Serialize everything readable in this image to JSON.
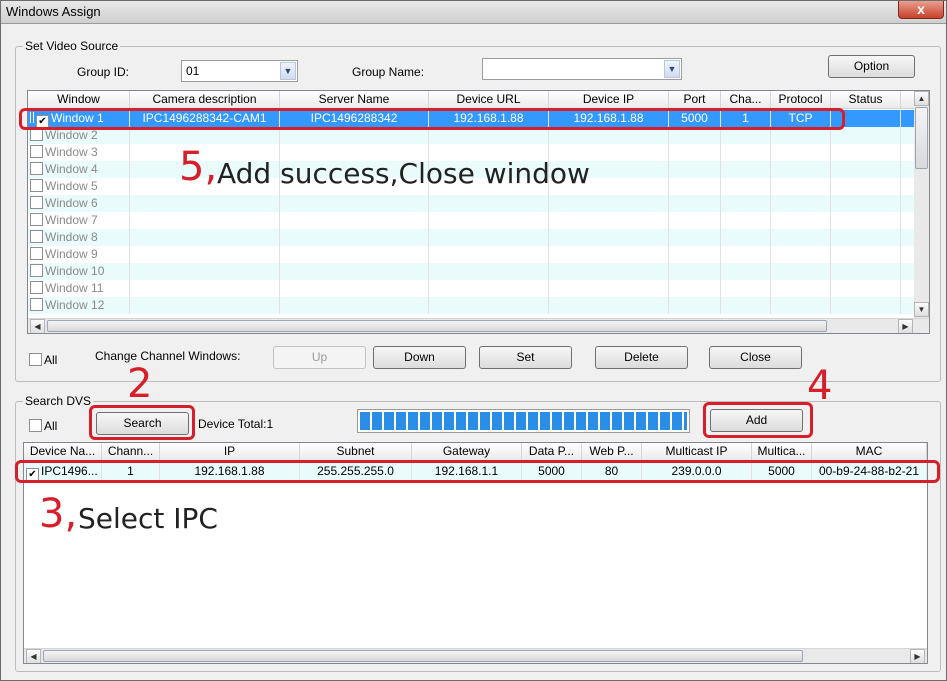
{
  "window": {
    "title": "Windows Assign",
    "close_glyph": "x"
  },
  "video_source": {
    "legend": "Set Video Source",
    "group_id_label": "Group ID:",
    "group_id_value": "01",
    "group_name_label": "Group Name:",
    "group_name_value": "",
    "option_button": "Option",
    "columns": [
      "Window",
      "Camera description",
      "Server Name",
      "Device URL",
      "Device IP",
      "Port",
      "Cha...",
      "Protocol",
      "Status"
    ],
    "rows": [
      {
        "window": "Window 1",
        "checked": true,
        "camera": "IPC1496288342-CAM1",
        "server": "IPC1496288342",
        "url": "192.168.1.88",
        "ip": "192.168.1.88",
        "port": "5000",
        "channel": "1",
        "protocol": "TCP",
        "status": ""
      },
      {
        "window": "Window 2"
      },
      {
        "window": "Window 3"
      },
      {
        "window": "Window 4"
      },
      {
        "window": "Window 5"
      },
      {
        "window": "Window 6"
      },
      {
        "window": "Window 7"
      },
      {
        "window": "Window 8"
      },
      {
        "window": "Window 9"
      },
      {
        "window": "Window 10"
      },
      {
        "window": "Window 11"
      },
      {
        "window": "Window 12"
      }
    ],
    "all_label": "All",
    "change_label": "Change Channel Windows:",
    "buttons": {
      "up": "Up",
      "down": "Down",
      "set": "Set",
      "delete": "Delete",
      "close": "Close"
    }
  },
  "search_dvs": {
    "legend": "Search DVS",
    "all_label": "All",
    "search_button": "Search",
    "device_total": "Device Total:1",
    "progress_percent": 100,
    "add_button": "Add",
    "columns": [
      "Device Na...",
      "Chann...",
      "IP",
      "Subnet",
      "Gateway",
      "Data P...",
      "Web  P...",
      "Multicast IP",
      "Multica...",
      "MAC"
    ],
    "rows": [
      {
        "checked": true,
        "name": "IPC1496...",
        "channel": "1",
        "ip": "192.168.1.88",
        "subnet": "255.255.255.0",
        "gateway": "192.168.1.1",
        "data_port": "5000",
        "web_port": "80",
        "multicast_ip": "239.0.0.0",
        "multicast_port": "5000",
        "mac": "00-b9-24-88-b2-21"
      }
    ]
  },
  "annotations": {
    "step5_num": "5,",
    "step5_text": "Add success,Close window",
    "step2_num": "2",
    "step4_num": "4",
    "step3_num": "3,",
    "step3_text": "Select IPC",
    "color": "#d61f2b"
  }
}
